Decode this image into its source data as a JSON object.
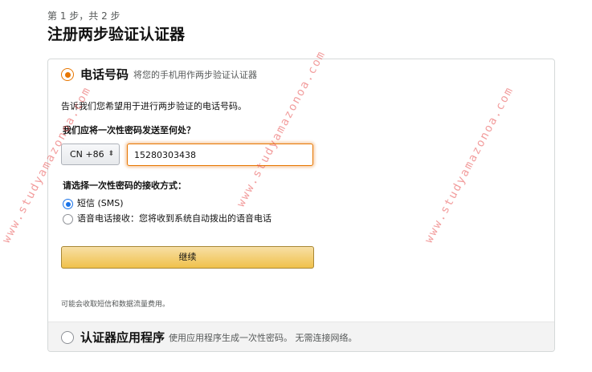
{
  "header": {
    "step": "第 1 步，共 2 步",
    "title": "注册两步验证认证器"
  },
  "phone_option": {
    "title": "电话号码",
    "description": "将您的手机用作两步验证认证器",
    "selected": true,
    "intro": "告诉我们您希望用于进行两步验证的电话号码。",
    "question": "我们应将一次性密码发送至何处？",
    "country_code": "CN +86",
    "phone_number": "15280303438",
    "method_question": "请选择一次性密码的接收方式：",
    "methods": [
      {
        "label": "短信 (SMS)",
        "selected": true
      },
      {
        "label": "语音电话接收：您将收到系统自动拨出的语音电话",
        "selected": false
      }
    ],
    "continue_label": "继续",
    "fee_note": "可能会收取短信和数据流量费用。"
  },
  "app_option": {
    "title": "认证器应用程序",
    "description": "使用应用程序生成一次性密码。 无需连接网络。",
    "selected": false
  },
  "watermark": {
    "text": "www.studyamazonoa.com"
  },
  "colors": {
    "accent_orange": "#e77600",
    "button_yellow": "#f0c14b",
    "radio_blue": "#1a73e8",
    "watermark": "#e74c4c"
  }
}
